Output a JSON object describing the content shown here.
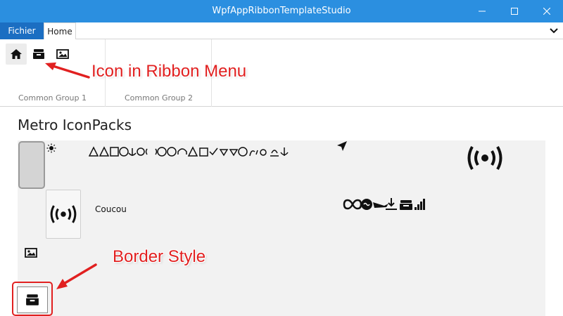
{
  "window": {
    "title": "WpfAppRibbonTemplateStudio"
  },
  "ribbon": {
    "file_tab": "Fichier",
    "home_tab": "Home",
    "groups": [
      {
        "label": "Common Group 1"
      },
      {
        "label": "Common Group 2"
      }
    ],
    "buttons": [
      {
        "icon": "home-icon"
      },
      {
        "icon": "archive-box-icon"
      },
      {
        "icon": "image-icon"
      }
    ]
  },
  "content": {
    "title": "Metro IconPacks",
    "card_label": "Coucou"
  },
  "annotations": {
    "ribbon_note": "Icon in Ribbon Menu",
    "border_note": "Border Style"
  },
  "colors": {
    "titlebar": "#2b8fe0",
    "file_tab": "#1b6ec2",
    "annotation": "#e12020"
  }
}
